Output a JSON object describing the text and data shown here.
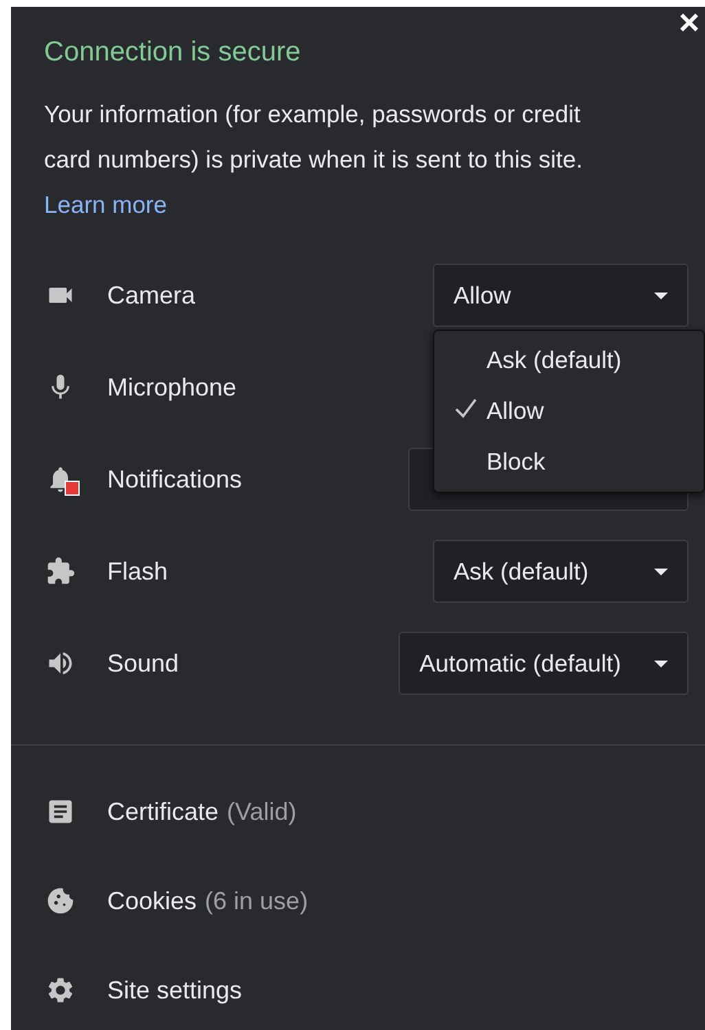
{
  "dialog": {
    "title": "Connection is secure",
    "description": "Your information (for example, passwords or credit card numbers) is private when it is sent to this site.",
    "link": "Learn more",
    "close": "×"
  },
  "permissions": [
    {
      "label": "Camera",
      "kind": "dropdown",
      "blocked": false,
      "value": "Allow",
      "options": [
        {
          "label": "Ask (default)",
          "selected": false
        },
        {
          "label": "Allow",
          "selected": true
        },
        {
          "label": "Block",
          "selected": false
        }
      ]
    },
    {
      "label": "Microphone",
      "kind": "plain",
      "blocked": false
    },
    {
      "label": "Notifications",
      "kind": "dropdown",
      "blocked": true
    },
    {
      "label": "Flash",
      "kind": "dropdown",
      "blocked": false,
      "value": "Ask (default)"
    },
    {
      "label": "Sound",
      "kind": "dropdown",
      "blocked": false,
      "value": "Automatic (default)"
    }
  ],
  "links": [
    {
      "label": "Certificate",
      "detail": "(Valid)"
    },
    {
      "label": "Cookies",
      "detail": "(6 in use)"
    },
    {
      "label": "Site settings"
    }
  ]
}
